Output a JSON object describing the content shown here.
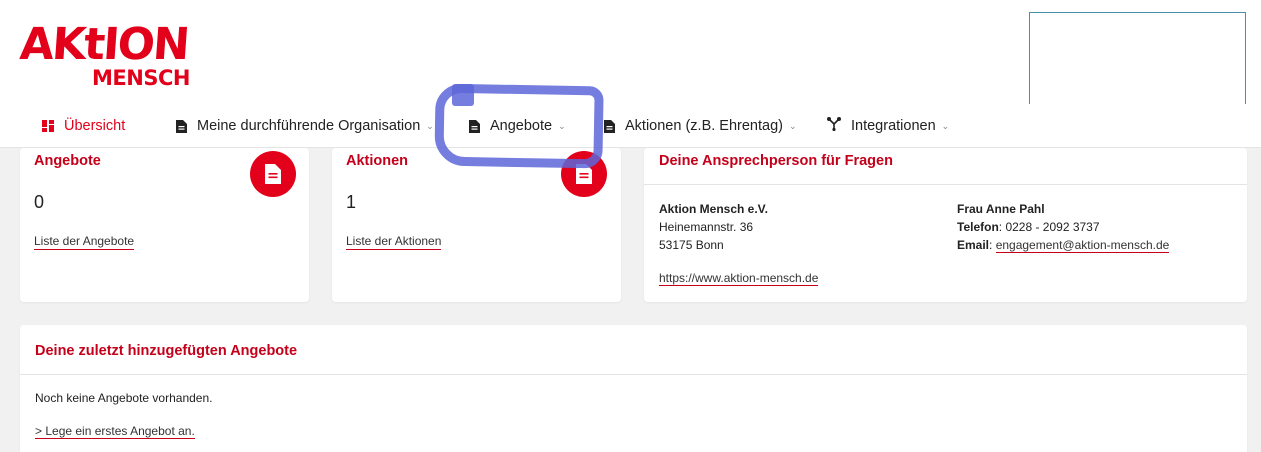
{
  "brand": {
    "logo_top": "AKtION",
    "logo_bottom": "MENSCH",
    "accent": "#e2001a",
    "highlight_color": "#5d66d8"
  },
  "nav": {
    "items": [
      {
        "label": "Übersicht",
        "icon": "dashboard-grid-icon",
        "active": true,
        "dropdown": false
      },
      {
        "label": "Meine durchführende Organisation",
        "icon": "document-icon",
        "dropdown": true
      },
      {
        "label": "Angebote",
        "icon": "document-icon",
        "dropdown": true
      },
      {
        "label": "Aktionen (z.B. Ehrentag)",
        "icon": "document-icon",
        "dropdown": true
      },
      {
        "label": "Integrationen",
        "icon": "network-icon",
        "dropdown": true
      }
    ],
    "chevron": "⌄"
  },
  "cards": {
    "angebote": {
      "title": "Angebote",
      "count": "0",
      "link": "Liste der Angebote",
      "icon": "document-icon"
    },
    "aktionen": {
      "title": "Aktionen",
      "count": "1",
      "link": "Liste der Aktionen",
      "icon": "document-icon"
    }
  },
  "contact": {
    "title": "Deine Ansprechperson für Fragen",
    "org_name": "Aktion Mensch e.V.",
    "street": "Heinemannstr. 36",
    "city": "53175 Bonn",
    "website": "https://www.aktion-mensch.de",
    "person": "Frau Anne Pahl",
    "phone_label": "Telefon",
    "phone": ": 0228 - 2092 3737",
    "email_label": "Email",
    "email_sep": ": ",
    "email": "engagement@aktion-mensch.de"
  },
  "recent": {
    "title": "Deine zuletzt hinzugefügten Angebote",
    "empty_text": "Noch keine Angebote vorhanden.",
    "create_link": "> Lege ein erstes Angebot an."
  }
}
